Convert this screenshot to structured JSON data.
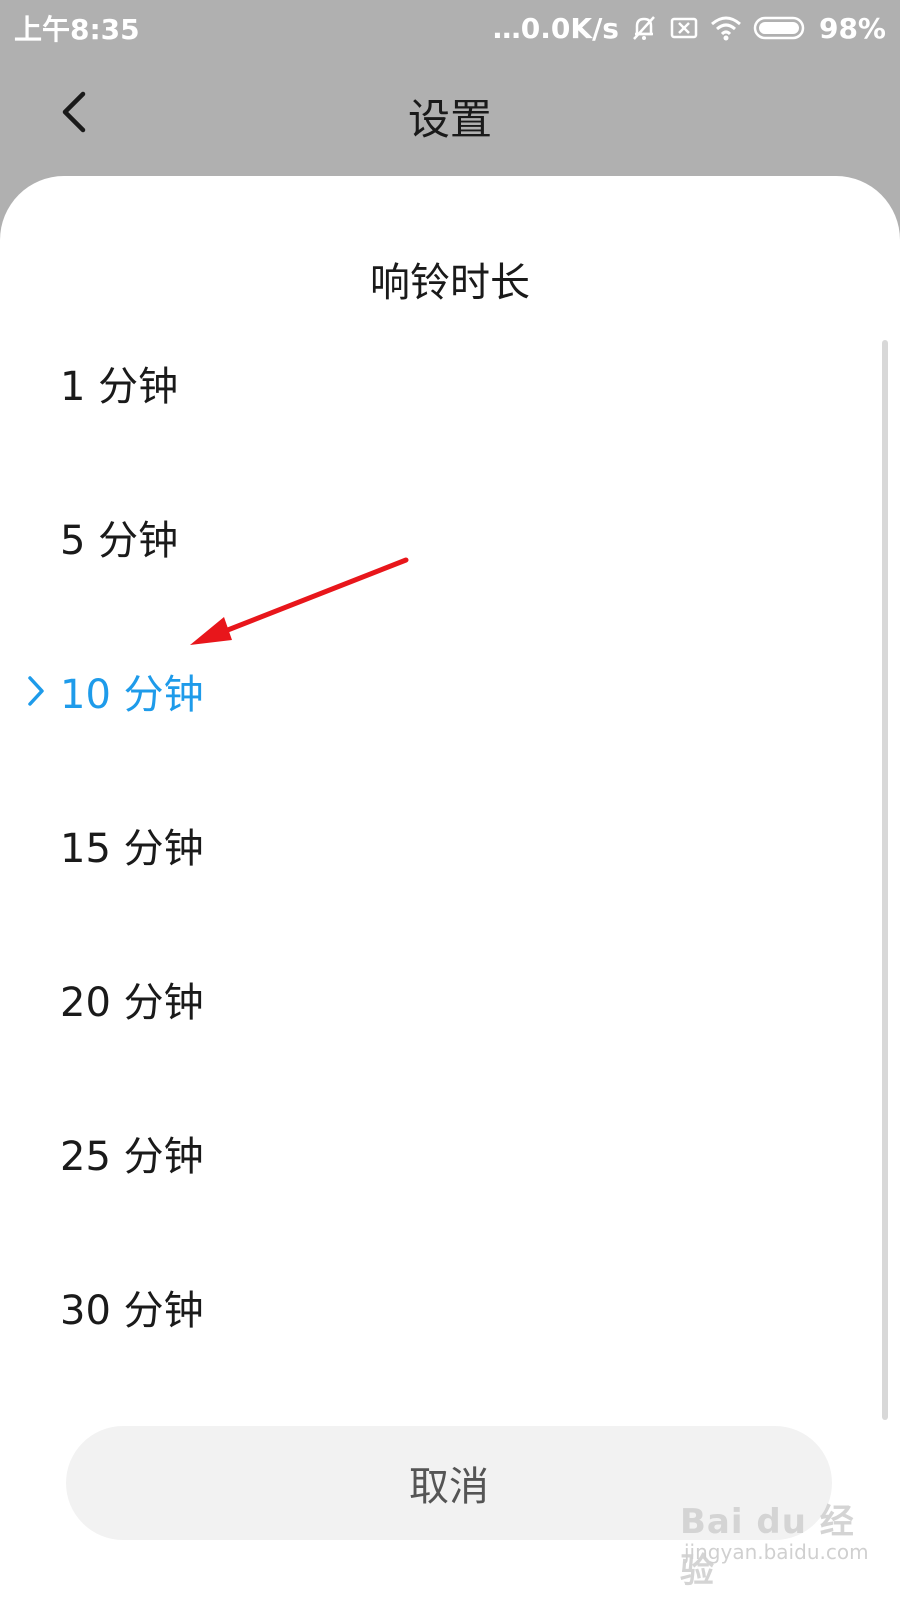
{
  "status_bar": {
    "time": "上午8:35",
    "network_speed": "…0.0K/s",
    "battery_percent": "98%",
    "icons": [
      "mute-bell-icon",
      "sim-x-icon",
      "wifi-icon",
      "battery-icon"
    ]
  },
  "header": {
    "title": "设置",
    "back_icon": "chevron-left-icon"
  },
  "dialog": {
    "title": "响铃时长",
    "options": [
      {
        "label": "1 分钟",
        "selected": false
      },
      {
        "label": "5 分钟",
        "selected": false
      },
      {
        "label": "10 分钟",
        "selected": true
      },
      {
        "label": "15 分钟",
        "selected": false
      },
      {
        "label": "20 分钟",
        "selected": false
      },
      {
        "label": "25 分钟",
        "selected": false
      },
      {
        "label": "30 分钟",
        "selected": false
      }
    ],
    "cancel_label": "取消"
  },
  "colors": {
    "accent": "#1e9bea",
    "annotation_arrow": "#e8161b",
    "dim_background": "#b0b0b0"
  },
  "watermark": {
    "logo_text": "Bai du 经验",
    "url": "jingyan.baidu.com"
  }
}
